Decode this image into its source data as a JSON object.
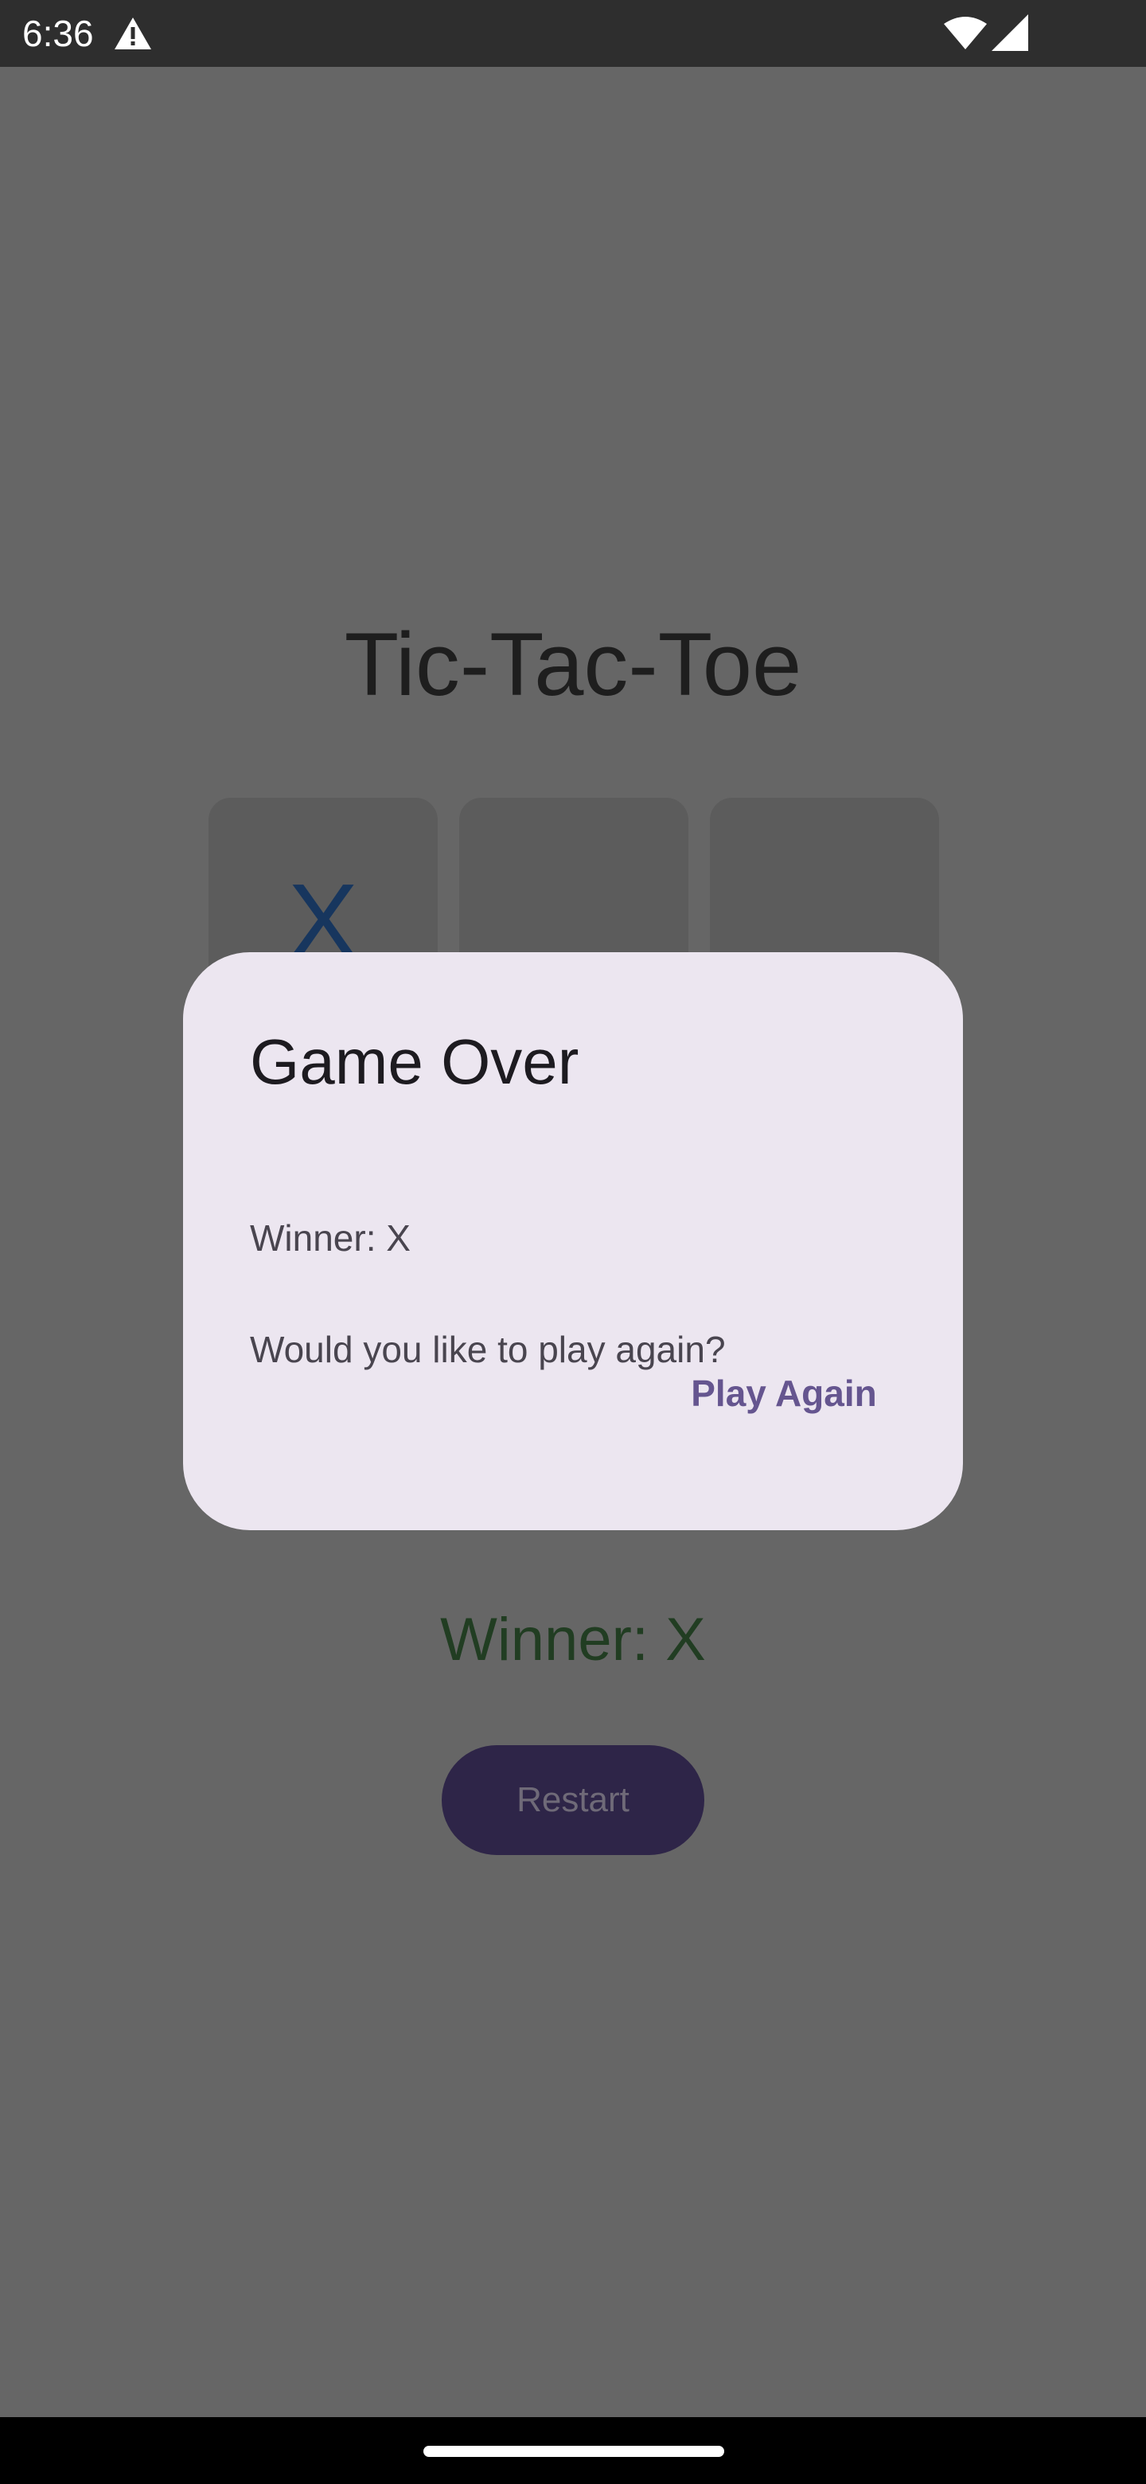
{
  "status_bar": {
    "time": "6:36",
    "icons": [
      "alert-icon",
      "wifi-icon",
      "signal-icon"
    ]
  },
  "app": {
    "title": "Tic-Tac-Toe",
    "board_visible_row": [
      "X",
      "",
      ""
    ],
    "winner_text": "Winner: X",
    "restart_label": "Restart"
  },
  "dialog": {
    "title": "Game Over",
    "message_line1": "Winner: X",
    "message_line2": "Would you like to play again?",
    "play_again_label": "Play Again"
  },
  "colors": {
    "scrim": "#666666",
    "dialog_bg": "#ece6f0",
    "accent": "#65558f",
    "x_mark": "#17365e",
    "winner_text": "#213d22"
  }
}
